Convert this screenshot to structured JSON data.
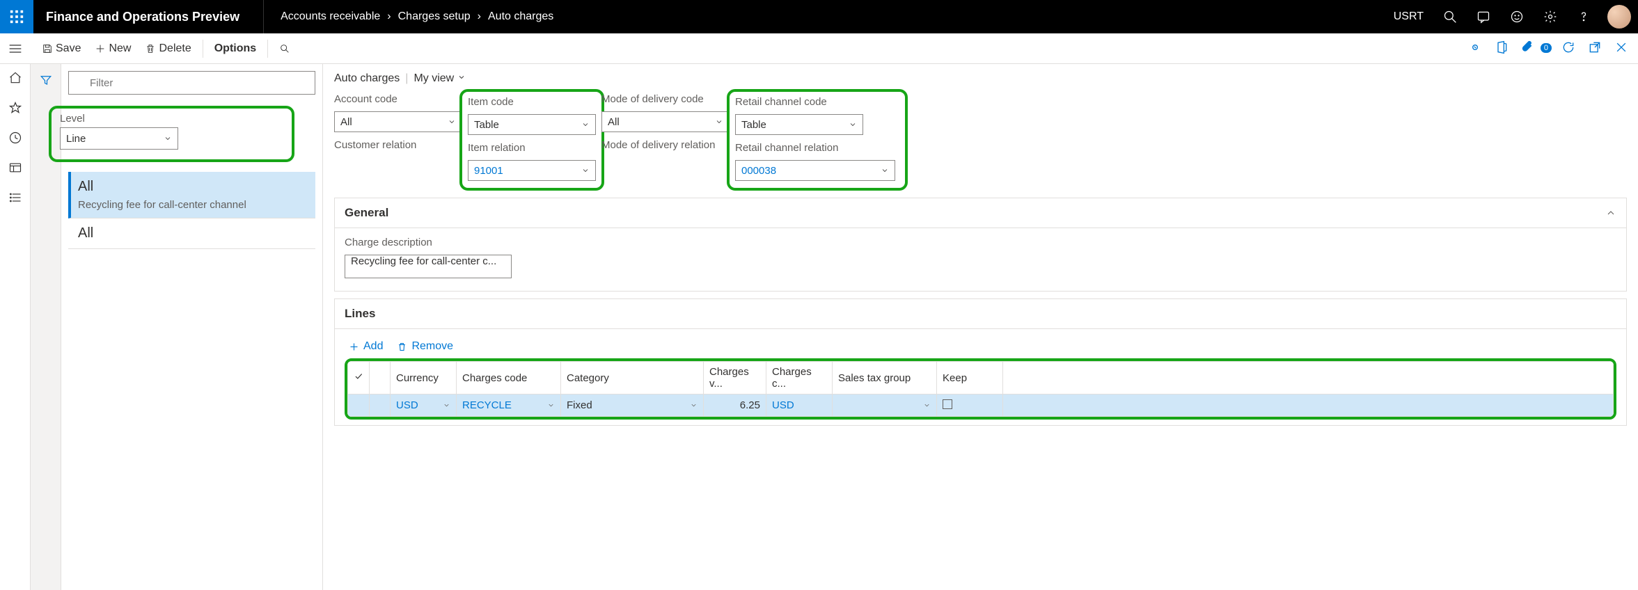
{
  "header": {
    "app_title": "Finance and Operations Preview",
    "breadcrumb": [
      "Accounts receivable",
      "Charges setup",
      "Auto charges"
    ],
    "company": "USRT"
  },
  "actions": {
    "save": "Save",
    "new": "New",
    "delete": "Delete",
    "options": "Options"
  },
  "list": {
    "filter_placeholder": "Filter",
    "level_label": "Level",
    "level_value": "Line",
    "items": [
      {
        "title": "All",
        "desc": "Recycling fee for call-center channel",
        "selected": true
      },
      {
        "title": "All",
        "desc": "",
        "selected": false
      }
    ]
  },
  "main": {
    "page_title": "Auto charges",
    "view_label": "My view",
    "codes": {
      "account_code": {
        "label": "Account code",
        "value": "All"
      },
      "customer_relation": {
        "label": "Customer relation",
        "value": ""
      },
      "item_code": {
        "label": "Item code",
        "value": "Table"
      },
      "item_relation": {
        "label": "Item relation",
        "value": "91001"
      },
      "delivery_code": {
        "label": "Mode of delivery code",
        "value": "All"
      },
      "delivery_relation": {
        "label": "Mode of delivery relation",
        "value": ""
      },
      "channel_code": {
        "label": "Retail channel code",
        "value": "Table"
      },
      "channel_relation": {
        "label": "Retail channel relation",
        "value": "000038"
      }
    },
    "general": {
      "section_label": "General",
      "desc_label": "Charge description",
      "desc_value": "Recycling fee for call-center c..."
    },
    "lines": {
      "section_label": "Lines",
      "add": "Add",
      "remove": "Remove",
      "columns": [
        "Currency",
        "Charges code",
        "Category",
        "Charges v...",
        "Charges c...",
        "Sales tax group",
        "Keep"
      ],
      "row": {
        "currency": "USD",
        "charges_code": "RECYCLE",
        "category": "Fixed",
        "charges_value": "6.25",
        "charges_currency": "USD",
        "sales_tax_group": "",
        "keep": false
      }
    }
  }
}
